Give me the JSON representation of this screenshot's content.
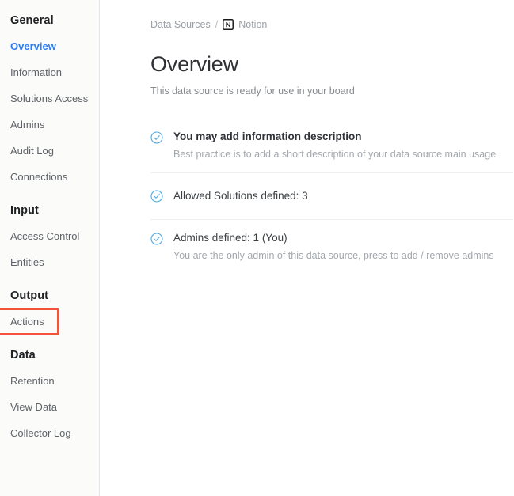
{
  "sidebar": {
    "groups": [
      {
        "title": "General",
        "items": [
          {
            "label": "Overview",
            "state": "active"
          },
          {
            "label": "Information",
            "state": "normal"
          },
          {
            "label": "Solutions Access",
            "state": "normal"
          },
          {
            "label": "Admins",
            "state": "normal"
          },
          {
            "label": "Audit Log",
            "state": "normal"
          },
          {
            "label": "Connections",
            "state": "normal"
          }
        ]
      },
      {
        "title": "Input",
        "items": [
          {
            "label": "Access Control",
            "state": "normal"
          },
          {
            "label": "Entities",
            "state": "normal"
          }
        ]
      },
      {
        "title": "Output",
        "items": [
          {
            "label": "Actions",
            "state": "highlighted"
          }
        ]
      },
      {
        "title": "Data",
        "items": [
          {
            "label": "Retention",
            "state": "normal"
          },
          {
            "label": "View Data",
            "state": "normal"
          },
          {
            "label": "Collector Log",
            "state": "normal"
          }
        ]
      }
    ]
  },
  "breadcrumb": {
    "root": "Data Sources",
    "separator": "/",
    "icon": "notion-icon",
    "current": "Notion"
  },
  "page": {
    "title": "Overview",
    "subtitle": "This data source is ready for use in your board"
  },
  "checklist": [
    {
      "icon": "check-circle-icon",
      "title": "You may add information description",
      "bold": true,
      "description": "Best practice is to add a short description of your data source main usage"
    },
    {
      "icon": "check-circle-icon",
      "title": "Allowed Solutions defined: 3",
      "bold": false,
      "description": ""
    },
    {
      "icon": "check-circle-icon",
      "title": "Admins defined: 1 (You)",
      "bold": false,
      "description": "You are the only admin of this data source, press to add / remove admins"
    }
  ],
  "colors": {
    "accent_blue": "#2b7cf6",
    "check_icon_blue": "#4fabdd",
    "highlight_red": "#f4523b",
    "sidebar_bg": "#fbfbfa",
    "divider": "#eceef0",
    "muted_text": "#9aa0a6"
  }
}
